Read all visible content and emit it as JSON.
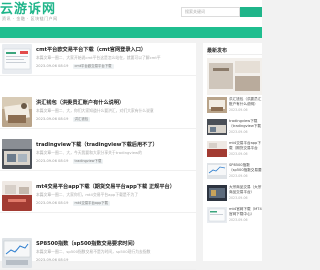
{
  "header": {
    "logo": "云游诉网",
    "logo_sub": "资讯 · 金融 · 区块链门户网",
    "search_placeholder": "搜索关键词"
  },
  "articles": [
    {
      "title": "cmt平台欧交易平台下载（cmt官网登录入口）",
      "desc": "本篇文章一图二、大家开始说cmt平台这是怎么站在，就要可以了解cmt平",
      "date": "2023-09-06 08:19",
      "tag": "cmt平台欧交易平台下载"
    },
    {
      "title": "洪汇钱包（洪委员汇账户有什么说明）",
      "desc": "本篇文章一图二、大，你们大家知道什么要洪汇，对们大家有什么说意",
      "date": "2023-09-06 08:19",
      "tag": "洪汇钱包"
    },
    {
      "title": "tradingview下载（tradingview下载后用不了）",
      "desc": "本篇文章一图二、大，今天我要和大家分享关于tradingview的",
      "date": "2023-09-06 08:19",
      "tag": "tradingview下载"
    },
    {
      "title": "mt4交易平台app下载（期货交易平台app下载 正规平台）",
      "desc": "本篇文章一图二、大家你们，mt4交易平台app下载是不为了",
      "date": "2023-09-06 08:19",
      "tag": "mt4交易平台app下载"
    },
    {
      "title": "SP8500指数（sp500指数交易要求时间）",
      "desc": "本篇文章一图二、sp500指数交易不是为时间，sp500现行为去指数",
      "date": "2023-09-06 08:19",
      "tag": "SP8500指数"
    }
  ],
  "sidebar": {
    "title": "最新发布",
    "items": [
      {
        "text": "洪汇钱包（洪委员汇账户有什么说明）",
        "date": "2023-09-06"
      },
      {
        "text": "tradingview下载（tradingview下载后用不了）",
        "date": "2023-09-06"
      },
      {
        "text": "mt4交易平台app下载（期货交易平台app下载）",
        "date": "2023-09-06"
      },
      {
        "text": "SP8500指数（sp500指数交易要求时间）",
        "date": "2023-09-06"
      },
      {
        "text": "大宗商品交易（大宗商品交易平台）",
        "date": "2023-09-06"
      },
      {
        "text": "mt4官网下载（MT4官网下载中心）",
        "date": "2023-09-06"
      }
    ]
  }
}
